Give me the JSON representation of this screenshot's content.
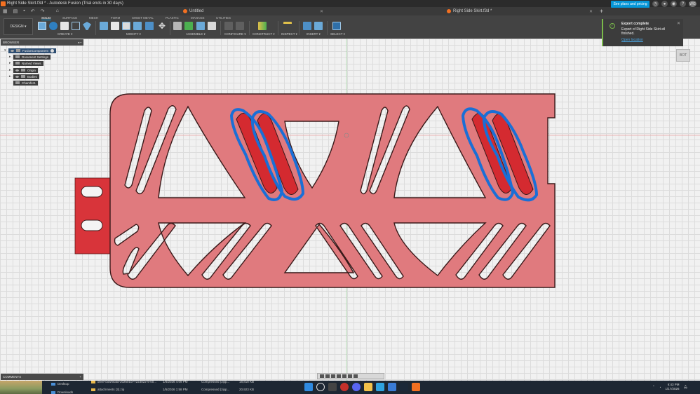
{
  "window": {
    "title": "Right Side Skirt.f3d * - Autodesk Fusion (Trial ends in 30 days)",
    "controls": [
      "–",
      "▢",
      "✕"
    ]
  },
  "tabs": [
    {
      "label": "Untitled",
      "close": "✕"
    },
    {
      "label": "Right Side Skirt.f3d *",
      "close": "✕"
    }
  ],
  "top_right": {
    "plans_button": "See plans and pricing",
    "avatar": "WG"
  },
  "toolbar": {
    "design_button": "DESIGN ▾",
    "workspace_tabs": [
      "SOLID",
      "SURFACE",
      "MESH",
      "FORM",
      "SHEET METAL",
      "PLASTIC",
      "MANAGE",
      "UTILITIES"
    ],
    "groups": [
      "CREATE ▾",
      "MODIFY ▾",
      "ASSEMBLE ▾",
      "CONFIGURE ▾",
      "CONSTRUCT ▾",
      "INSPECT ▾",
      "INSERT ▾",
      "SELECT ▾"
    ]
  },
  "browser": {
    "title": "BROWSER",
    "items": [
      {
        "label": "FusionComponent"
      },
      {
        "label": "Document Settings"
      },
      {
        "label": "Named Views"
      },
      {
        "label": "Origin"
      },
      {
        "label": "Bodies"
      },
      {
        "label": "Chamfer1"
      }
    ]
  },
  "notification": {
    "title": "Export complete",
    "message": "Export of Right Side Skirt.stl finished.",
    "link": "Open location"
  },
  "viewcube": {
    "label": "BOT"
  },
  "comments": {
    "title": "COMMENTS"
  },
  "taskbar": {
    "folders": [
      {
        "name": "Desktop"
      },
      {
        "name": "Downloads"
      }
    ],
    "files": [
      {
        "name": "drive-download-20260107T223822-5-00...",
        "date": "1/5/2026 4:09 PM",
        "type": "Compressed (zipp...",
        "size": "18,818 KB"
      },
      {
        "name": "attachments (3).zip",
        "date": "1/5/2026 1:58 PM",
        "type": "Compressed (zipp...",
        "size": "20,923 KB"
      }
    ],
    "time": "6:43 PM",
    "date": "1/17/2026"
  },
  "colors": {
    "part_fill": "#e07a7e",
    "part_edge": "#3a1a1a",
    "tab_fill": "#d8343a",
    "highlight_face": "#d42a30",
    "selection_outline": "#1a6fd6",
    "accent": "#0696d7"
  }
}
